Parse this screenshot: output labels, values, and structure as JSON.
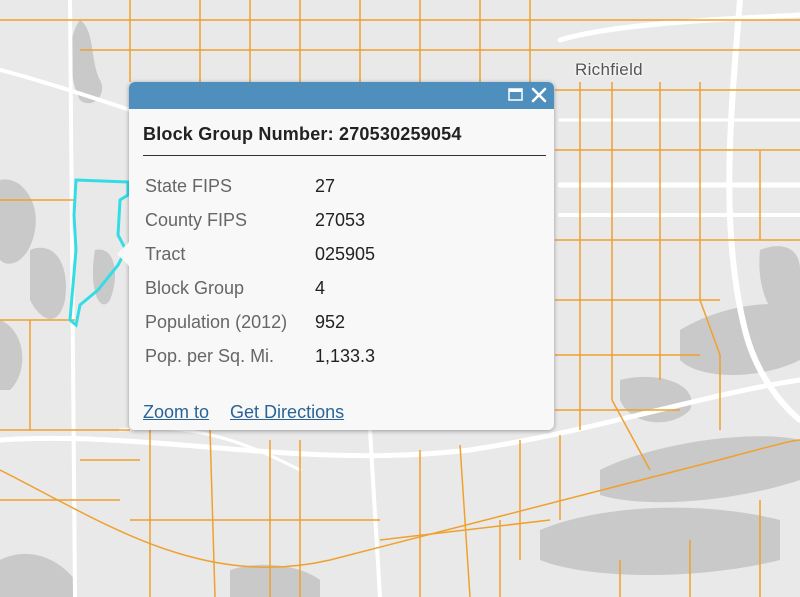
{
  "map": {
    "place_label": "Richfield",
    "colors": {
      "background": "#e9e9e9",
      "water": "#c9c9c9",
      "roads": "#ffffff",
      "boundaries": "#f0a02e",
      "selection": "#33dde6"
    }
  },
  "popup": {
    "title": "Block Group Number: 270530259054",
    "header_color": "#4f8fbd",
    "fields": [
      {
        "label": "State FIPS",
        "value": "27"
      },
      {
        "label": "County FIPS",
        "value": "27053"
      },
      {
        "label": "Tract",
        "value": "025905"
      },
      {
        "label": "Block Group",
        "value": "4"
      },
      {
        "label": "Population (2012)",
        "value": "952"
      },
      {
        "label": "Pop. per Sq. Mi.",
        "value": "1,133.3"
      }
    ],
    "actions": {
      "zoom": "Zoom to",
      "directions": "Get Directions"
    },
    "icons": {
      "maximize": "maximize-icon",
      "close": "close-icon"
    }
  }
}
